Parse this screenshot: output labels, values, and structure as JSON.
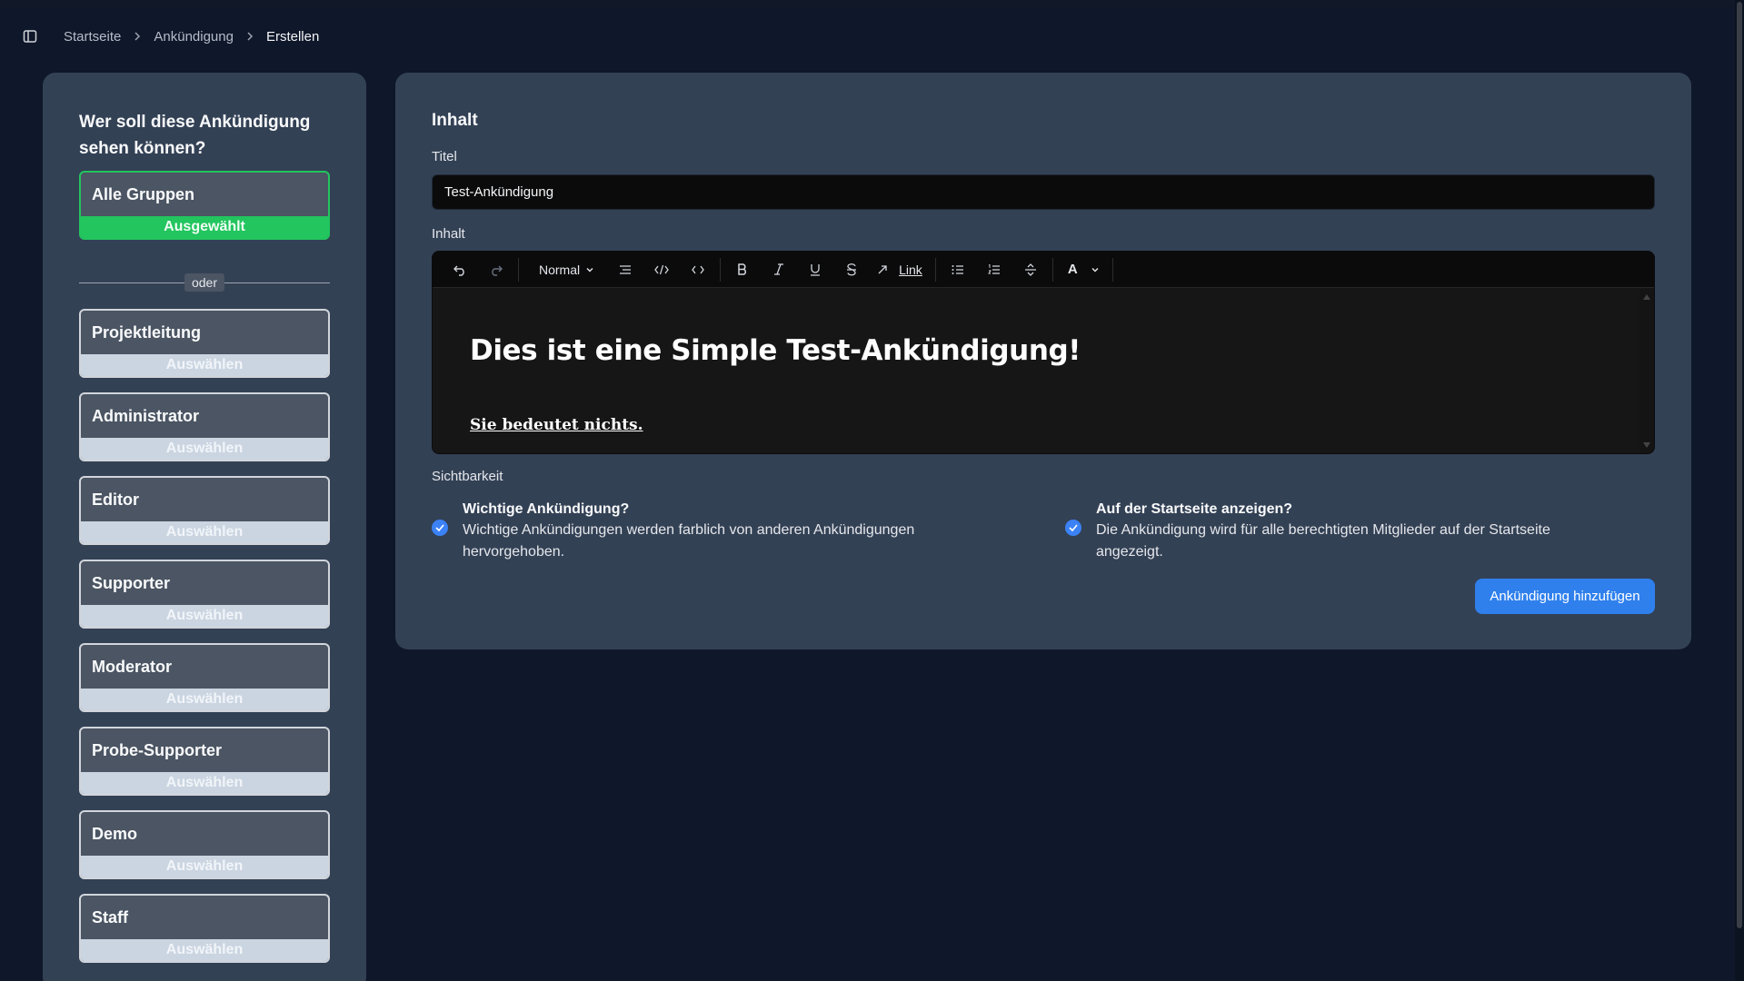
{
  "breadcrumb": {
    "items": [
      "Startseite",
      "Ankündigung"
    ],
    "current": "Erstellen"
  },
  "groups": {
    "question": "Wer soll diese Ankündigung sehen können?",
    "all_groups": {
      "name": "Alle Gruppen",
      "action": "Ausgewählt"
    },
    "divider": "oder",
    "items": [
      {
        "name": "Projektleitung",
        "action": "Auswählen"
      },
      {
        "name": "Administrator",
        "action": "Auswählen"
      },
      {
        "name": "Editor",
        "action": "Auswählen"
      },
      {
        "name": "Supporter",
        "action": "Auswählen"
      },
      {
        "name": "Moderator",
        "action": "Auswählen"
      },
      {
        "name": "Probe-Supporter",
        "action": "Auswählen"
      },
      {
        "name": "Demo",
        "action": "Auswählen"
      },
      {
        "name": "Staff",
        "action": "Auswählen"
      }
    ]
  },
  "content": {
    "section_title": "Inhalt",
    "title_label": "Titel",
    "title_value": "Test-Ankündigung",
    "body_label": "Inhalt",
    "toolbar": {
      "block_format": "Normal",
      "link_label": "Link",
      "font_label": "A"
    },
    "editor": {
      "heading": "Dies ist eine Simple Test-Ankündigung!",
      "paragraph": "Sie bedeutet nichts."
    },
    "visibility_label": "Sichtbarkeit",
    "important": {
      "title": "Wichtige Ankündigung?",
      "desc_line1": "Wichtige Ankündigungen werden farblich von anderen Ankündigungen",
      "desc_line2": "hervorgehoben.",
      "checked": true
    },
    "homepage": {
      "title": "Auf der Startseite anzeigen?",
      "desc_line1": "Die Ankündigung wird für alle berechtigten Mitglieder auf der Startseite",
      "desc_line2": "angezeigt.",
      "checked": true
    },
    "submit_label": "Ankündigung hinzufügen"
  },
  "colors": {
    "background": "#0f172a",
    "panel": "#334155",
    "selected": "#22c55e",
    "accent": "#2f80ed"
  }
}
